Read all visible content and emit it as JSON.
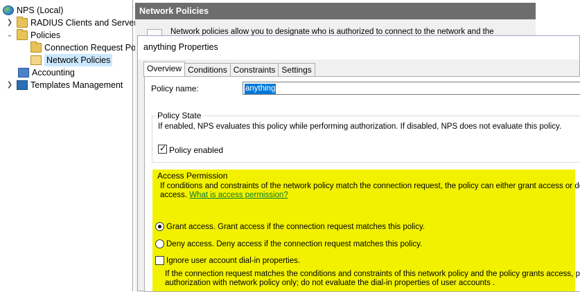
{
  "tree": {
    "root": "NPS (Local)",
    "items": [
      {
        "label": "RADIUS Clients and Servers"
      },
      {
        "label": "Policies"
      },
      {
        "label": "Connection Request Po"
      },
      {
        "label": "Network Policies"
      },
      {
        "label": "Accounting"
      },
      {
        "label": "Templates Management"
      }
    ]
  },
  "main": {
    "header": "Network Policies",
    "info": "Network policies allow you to designate who is authorized to connect to the network and the"
  },
  "dialog": {
    "title": "anything Properties",
    "tabs": [
      "Overview",
      "Conditions",
      "Constraints",
      "Settings"
    ],
    "policy_name_label": "Policy name:",
    "policy_name_value": "anything",
    "policy_state": {
      "title": "Policy State",
      "desc": "If enabled, NPS evaluates this policy while performing authorization. If disabled, NPS does not evaluate this policy.",
      "enabled_label": "Policy enabled"
    },
    "access_permission": {
      "title": "Access Permission",
      "desc_line1": "If conditions and constraints of the network policy match the connection request, the policy can either grant access or deny",
      "desc_line2": "access.",
      "link": "What is access permission?",
      "grant_label": "Grant access. Grant access if the connection request matches this policy.",
      "deny_label": "Deny access. Deny access if the connection request matches this policy.",
      "ignore_label": "Ignore user account dial-in properties.",
      "ignore_desc1": "If the connection request matches the conditions and constraints of this network policy and the policy grants access, perform",
      "ignore_desc2": "authorization with network policy only; do not evaluate the dial-in properties of user accounts ."
    }
  },
  "colors": {
    "highlight": "#f2f200",
    "selection": "#0078d7",
    "tree_selection": "#cce8ff",
    "header_bg": "#6d6d6d"
  }
}
